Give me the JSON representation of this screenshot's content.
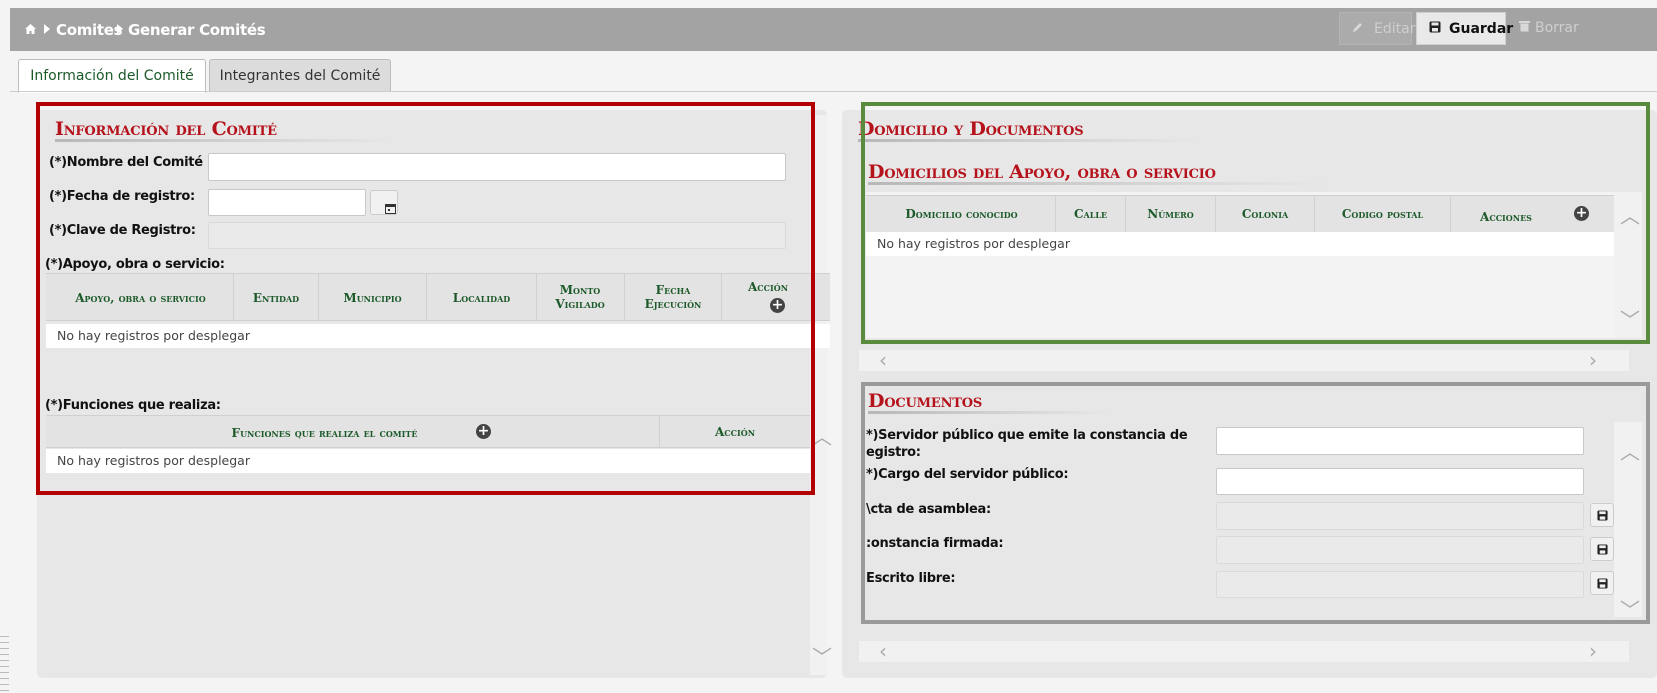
{
  "breadcrumb": {
    "home_icon": "home-icon",
    "item1": "Comites",
    "item2": "Generar Comités"
  },
  "toolbar": {
    "edit_label": "Editar",
    "save_label": "Guardar",
    "delete_label": "Borrar"
  },
  "tabs": [
    {
      "label": "Información del Comité"
    },
    {
      "label": "Integrantes del Comité"
    }
  ],
  "left": {
    "title": "Información del Comité",
    "name_label": "(*)Nombre del Comité",
    "date_label": "(*)Fecha de registro:",
    "key_label": "(*)Clave de Registro:",
    "support_label": "(*)Apoyo, obra o servicio:",
    "support_table": {
      "headers": [
        "Apoyo, obra o servicio",
        "Entidad",
        "Municipio",
        "Localidad",
        "Monto Vigilado",
        "Fecha Ejecución",
        "Acción"
      ],
      "empty": "No hay registros por desplegar"
    },
    "functions_label": "(*)Funciones que realiza:",
    "functions_table": {
      "headers": [
        "Funciones que realiza el comité",
        "Acción"
      ],
      "empty": "No hay registros por desplegar"
    }
  },
  "right": {
    "title": "Domicilio y Documentos",
    "addresses_title": "Domicilios del Apoyo, obra o servicio",
    "addresses_table": {
      "headers": [
        "Domicilio conocido",
        "Calle",
        "Número",
        "Colonia",
        "Codigo postal",
        "Acciones"
      ],
      "empty": "No hay registros por desplegar"
    },
    "documents_title": "Documentos",
    "doc_fields": [
      "*)Servidor público que emite la constancia de",
      "egistro:",
      "*)Cargo del servidor público:",
      "\\cta de asamblea:",
      ":onstancia firmada:",
      "Escrito libre:"
    ]
  },
  "colors": {
    "header_bg": "#a3a3a3",
    "title_red": "#b5121b",
    "header_green": "#1c5a2a",
    "highlight_red": "#b30000",
    "highlight_green": "#5a8a3c",
    "highlight_gray": "#9a9a9a"
  }
}
